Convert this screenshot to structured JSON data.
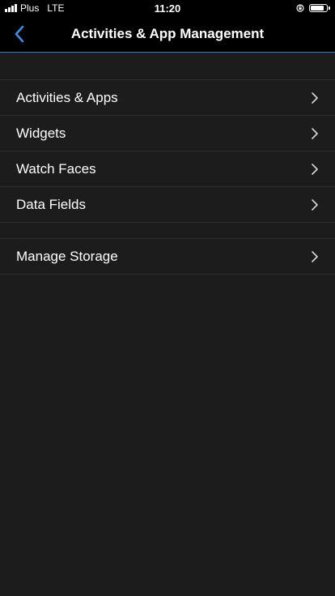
{
  "status_bar": {
    "carrier": "Plus",
    "network": "LTE",
    "time": "11:20",
    "battery_level": 0.85
  },
  "nav": {
    "title": "Activities & App Management",
    "back_icon": "chevron-left-icon",
    "accent_color": "#3a7bbf"
  },
  "menu_groups": [
    {
      "items": [
        {
          "label": "Activities & Apps"
        },
        {
          "label": "Widgets"
        },
        {
          "label": "Watch Faces"
        },
        {
          "label": "Data Fields"
        }
      ]
    },
    {
      "items": [
        {
          "label": "Manage Storage"
        }
      ]
    }
  ]
}
